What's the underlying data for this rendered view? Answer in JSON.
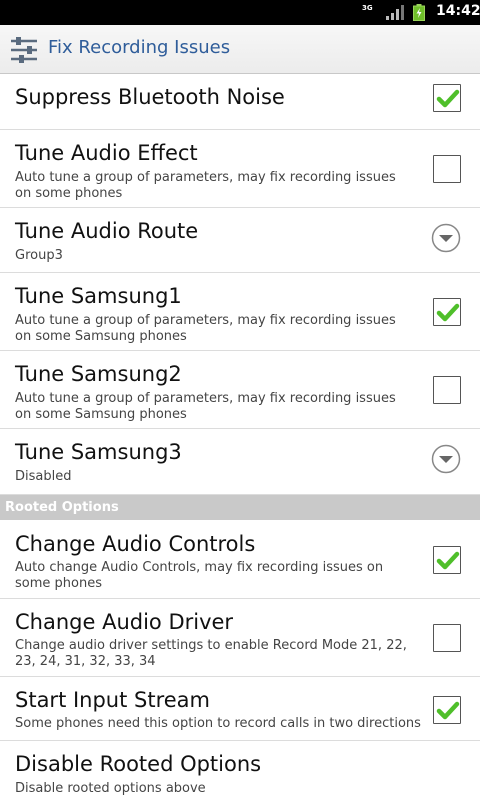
{
  "status_bar": {
    "network": "3G",
    "time": "14:42"
  },
  "title_bar": {
    "title": "Fix Recording Issues",
    "icon": "settings-sliders-icon"
  },
  "items": [
    {
      "title": "Suppress Bluetooth Noise",
      "summary": "",
      "widget": "checkbox",
      "checked": true
    },
    {
      "title": "Tune Audio Effect",
      "summary": "Auto tune a group of parameters, may fix recording issues on some phones",
      "widget": "checkbox",
      "checked": false
    },
    {
      "title": "Tune Audio Route",
      "summary": "Group3",
      "widget": "dropdown"
    },
    {
      "title": "Tune Samsung1",
      "summary": "Auto tune a group of parameters, may fix recording issues on some Samsung phones",
      "widget": "checkbox",
      "checked": true
    },
    {
      "title": "Tune Samsung2",
      "summary": "Auto tune a group of parameters, may fix recording issues on some Samsung phones",
      "widget": "checkbox",
      "checked": false
    },
    {
      "title": "Tune Samsung3",
      "summary": "Disabled",
      "widget": "dropdown"
    }
  ],
  "rooted_section": {
    "header": "Rooted Options",
    "items": [
      {
        "title": "Change Audio Controls",
        "summary": "Auto change Audio Controls, may fix recording issues on some phones",
        "widget": "checkbox",
        "checked": true
      },
      {
        "title": "Change Audio Driver",
        "summary": "Change audio driver settings to enable Record Mode 21, 22, 23, 24, 31, 32, 33, 34",
        "widget": "checkbox",
        "checked": false
      },
      {
        "title": "Start Input Stream",
        "summary": "Some phones need this option to record calls in two directions",
        "widget": "checkbox",
        "checked": true
      },
      {
        "title": "Disable Rooted Options",
        "summary": "Disable rooted options above",
        "widget": "none"
      }
    ]
  },
  "colors": {
    "title_blue": "#2f5d9a",
    "check_green": "#4fbf2a",
    "section_gray": "#c9c9c9"
  }
}
